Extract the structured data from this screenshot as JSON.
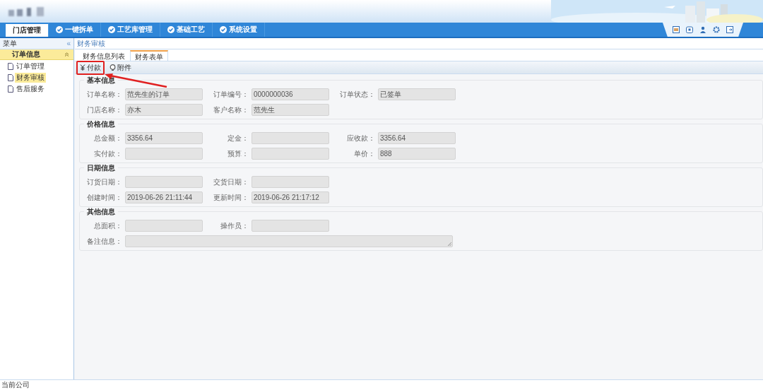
{
  "nav_tabs": [
    {
      "label": "门店管理",
      "selected": true
    },
    {
      "label": "一键拆单",
      "selected": false
    },
    {
      "label": "工艺库管理",
      "selected": false
    },
    {
      "label": "基础工艺",
      "selected": false
    },
    {
      "label": "系统设置",
      "selected": false
    }
  ],
  "sidebar": {
    "title": "菜单",
    "collapse": "«",
    "group": {
      "label": "订单信息",
      "expanded": true,
      "items": [
        {
          "label": "订单管理",
          "selected": false
        },
        {
          "label": "财务审核",
          "selected": true
        },
        {
          "label": "售后服务",
          "selected": false
        }
      ]
    }
  },
  "breadcrumb": "财务审核",
  "tabs": [
    {
      "label": "财务信息列表",
      "selected": false
    },
    {
      "label": "财务表单",
      "selected": true
    }
  ],
  "toolbar": [
    {
      "kind": "pay",
      "label": "付款",
      "highlighted": true
    },
    {
      "kind": "attach",
      "label": "附件",
      "highlighted": false
    }
  ],
  "sections": [
    {
      "title": "基本信息",
      "rows": [
        [
          {
            "label": "订单名称：",
            "value": "范先生的订单"
          },
          {
            "label": "订单编号：",
            "value": "0000000036"
          },
          {
            "label": "订单状态：",
            "value": "已签单"
          }
        ],
        [
          {
            "label": "门店名称：",
            "value": "亦木"
          },
          {
            "label": "客户名称：",
            "value": "范先生"
          }
        ]
      ]
    },
    {
      "title": "价格信息",
      "rows": [
        [
          {
            "label": "总金额：",
            "value": "3356.64"
          },
          {
            "label": "定金："
          },
          {
            "label": "应收款：",
            "value": "3356.64"
          }
        ],
        [
          {
            "label": "实付款："
          },
          {
            "label": "预算："
          },
          {
            "label": "单价：",
            "value": "888"
          }
        ]
      ]
    },
    {
      "title": "日期信息",
      "rows": [
        [
          {
            "label": "订货日期："
          },
          {
            "label": "交货日期："
          }
        ],
        [
          {
            "label": "创建时间：",
            "value": "2019-06-26 21:11:44"
          },
          {
            "label": "更新时间：",
            "value": "2019-06-26 21:17:12"
          }
        ]
      ]
    },
    {
      "title": "其他信息",
      "rows": [
        [
          {
            "label": "总面积："
          },
          {
            "label": "操作员："
          }
        ],
        [
          {
            "label": "备注信息：",
            "kind": "textarea"
          }
        ]
      ]
    }
  ],
  "status_bar": "当前公司"
}
